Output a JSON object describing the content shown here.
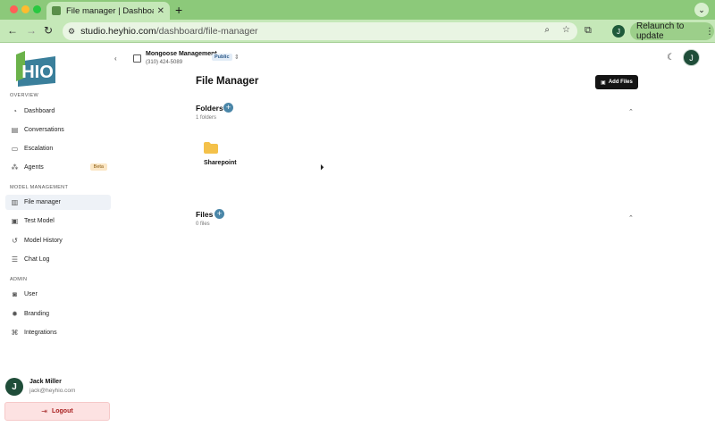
{
  "browser": {
    "tab_title": "File manager | Dashboard - H",
    "url_host": "studio.heyhio.com",
    "url_path": "/dashboard/file-manager",
    "profile_initial": "J",
    "relaunch_label": "Relaunch to update"
  },
  "sidebar": {
    "logo_text": "HIO",
    "sections": {
      "overview": "OVERVIEW",
      "model_management": "MODEL MANAGEMENT",
      "admin": "ADMIN"
    },
    "items": [
      {
        "label": "Dashboard",
        "icon": "dashboard-icon"
      },
      {
        "label": "Conversations",
        "icon": "conversations-icon"
      },
      {
        "label": "Escalation",
        "icon": "escalation-icon"
      },
      {
        "label": "Agents",
        "icon": "agents-icon",
        "badge": "Beta"
      },
      {
        "label": "File manager",
        "icon": "file-manager-icon",
        "active": true
      },
      {
        "label": "Test Model",
        "icon": "test-model-icon"
      },
      {
        "label": "Model History",
        "icon": "history-icon"
      },
      {
        "label": "Chat Log",
        "icon": "chat-log-icon"
      },
      {
        "label": "User",
        "icon": "user-icon"
      },
      {
        "label": "Branding",
        "icon": "branding-icon"
      },
      {
        "label": "Integrations",
        "icon": "integrations-icon"
      }
    ],
    "user": {
      "initial": "J",
      "name": "Jack Miller",
      "email": "jack@heyhio.com"
    },
    "logout_label": "Logout"
  },
  "header": {
    "org_name": "Mongoose Management",
    "org_phone": "(310) 424-5089",
    "org_badge": "Public",
    "avatar_initial": "J"
  },
  "main": {
    "title": "File Manager",
    "add_files_label": "Add Files",
    "folders": {
      "title": "Folders",
      "count": "1 folders",
      "items": [
        {
          "name": "Sharepoint"
        }
      ]
    },
    "files": {
      "title": "Files",
      "count": "0 files"
    }
  },
  "colors": {
    "accent": "#4a86a8",
    "browser_green": "#8cc97a",
    "avatar": "#1f4d39",
    "logout_bg": "#fde2e2"
  }
}
